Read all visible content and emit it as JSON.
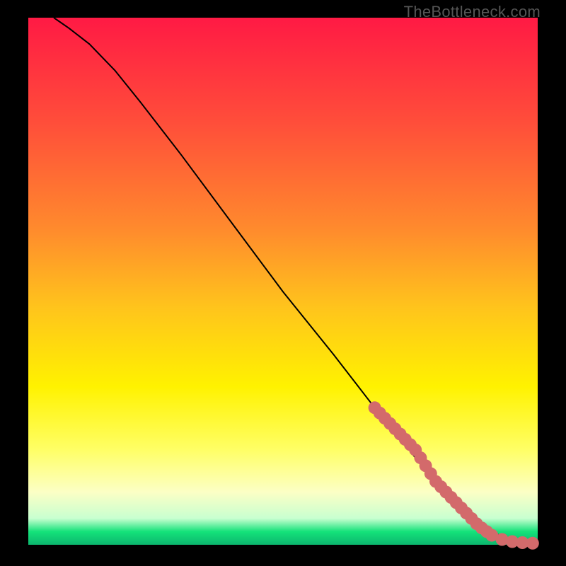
{
  "watermark": "TheBottleneck.com",
  "colors": {
    "background_frame": "#000000",
    "curve": "#000000",
    "points": "#d36a6b",
    "gradient_stops": [
      {
        "offset": 0.0,
        "color": "#ff1a44"
      },
      {
        "offset": 0.2,
        "color": "#ff4e3a"
      },
      {
        "offset": 0.4,
        "color": "#ff8a2d"
      },
      {
        "offset": 0.55,
        "color": "#ffc41c"
      },
      {
        "offset": 0.7,
        "color": "#fff200"
      },
      {
        "offset": 0.82,
        "color": "#ffff66"
      },
      {
        "offset": 0.9,
        "color": "#fcffc5"
      },
      {
        "offset": 0.95,
        "color": "#c8ffd0"
      },
      {
        "offset": 0.975,
        "color": "#14e27a"
      },
      {
        "offset": 1.0,
        "color": "#0cb66e"
      }
    ]
  },
  "chart_data": {
    "type": "line",
    "title": "",
    "xlabel": "",
    "ylabel": "",
    "xlim": [
      0,
      100
    ],
    "ylim": [
      0,
      100
    ],
    "series": [
      {
        "name": "curve",
        "kind": "line",
        "x": [
          5,
          8,
          12,
          17,
          22,
          30,
          40,
          50,
          60,
          68,
          74,
          78,
          82,
          85,
          88,
          90,
          92,
          94,
          96,
          98,
          100
        ],
        "y": [
          100,
          98,
          95,
          90,
          84,
          74,
          61,
          48,
          36,
          26,
          19,
          14,
          10,
          7,
          4.5,
          3,
          2,
          1.3,
          0.8,
          0.4,
          0.2
        ]
      },
      {
        "name": "points",
        "kind": "scatter",
        "x": [
          68,
          69,
          70,
          71,
          72,
          73,
          74,
          75,
          76,
          77,
          78,
          79,
          80,
          81,
          82,
          83,
          84,
          85,
          86,
          87,
          88,
          89,
          90,
          91,
          93,
          95,
          97,
          99
        ],
        "y": [
          26,
          25,
          24,
          23,
          22,
          21,
          20,
          19,
          18,
          16.5,
          15,
          13.5,
          12,
          11,
          10,
          9,
          8,
          7,
          6,
          5,
          4,
          3.2,
          2.5,
          1.8,
          1.0,
          0.6,
          0.4,
          0.3
        ]
      }
    ]
  }
}
